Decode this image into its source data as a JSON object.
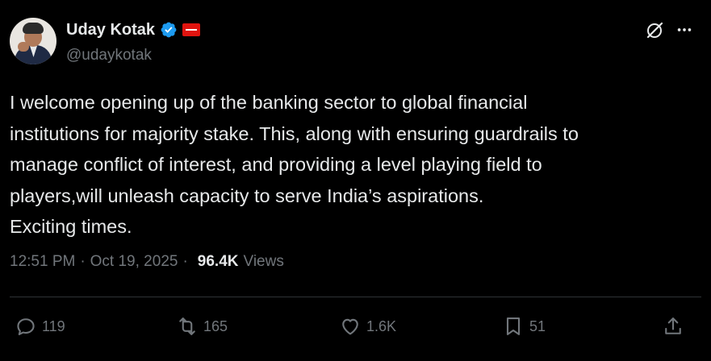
{
  "author": {
    "display_name": "Uday Kotak",
    "handle": "@udaykotak"
  },
  "tweet": {
    "text": "I welcome opening up of the banking sector to global financial\ninstitutions for majority stake. This, along with ensuring guardrails to\nmanage conflict of interest, and providing a level playing field to\nplayers,will unleash capacity to serve India’s aspirations.\nExciting times."
  },
  "meta": {
    "time": "12:51 PM",
    "separator": "·",
    "date": "Oct 19, 2025",
    "views_count": "96.4K",
    "views_label": "Views"
  },
  "actions": {
    "replies": "119",
    "reposts": "165",
    "likes": "1.6K",
    "bookmarks": "51"
  },
  "icons": {
    "verified": "verified-badge-icon",
    "affiliation": "affiliation-flag-icon",
    "grok": "grok-icon",
    "more": "more-icon",
    "reply": "reply-icon",
    "repost": "repost-icon",
    "like": "heart-icon",
    "bookmark": "bookmark-icon",
    "share": "share-icon"
  },
  "colors": {
    "background": "#000000",
    "text": "#e7e9ea",
    "muted": "#71767b",
    "verified": "#1d9bf0",
    "flag": "#e0140f"
  }
}
